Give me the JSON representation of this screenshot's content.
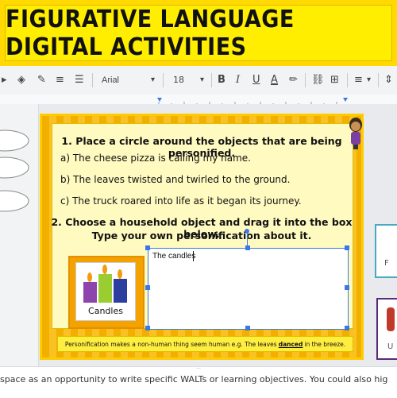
{
  "banner": {
    "title": "FIGURATIVE LANGUAGE DIGITAL ACTIVITIES"
  },
  "toolbar": {
    "font": "Arial",
    "font_size": "18",
    "bold": "B",
    "italic": "I",
    "underline": "U",
    "text_color": "A",
    "icons": [
      "undo-icon",
      "paint-format-icon",
      "pen-icon",
      "line-icon",
      "line-style-icon",
      "bold-icon",
      "italic-icon",
      "underline-icon",
      "text-color-icon",
      "highlight-icon",
      "link-icon",
      "insert-comment-icon",
      "align-icon",
      "line-spacing-icon"
    ]
  },
  "slide": {
    "q1": "1. Place a circle around the objects that are being personified.",
    "a": "a) The cheese pizza is calling my name.",
    "b": "b) The leaves twisted and twirled to the ground.",
    "c": "c) The truck roared into life as it began its journey.",
    "q2_line1": "2. Choose a household object and drag it into the box below.",
    "q2_line2": "Type your own personification about it.",
    "candle_label": "Candles",
    "textbox_value": "The candles",
    "footer_before": "Personification makes a non-human thing seem human e.g. The leaves ",
    "footer_emph": "danced",
    "footer_after": " in the breeze."
  },
  "notes": {
    "text": "space as an opportunity to write specific WALTs or learning objectives. You could also hig"
  },
  "colors": {
    "banner": "#ffee00",
    "slide_border": "#f0a800",
    "accent_blue": "#3b78e7"
  }
}
